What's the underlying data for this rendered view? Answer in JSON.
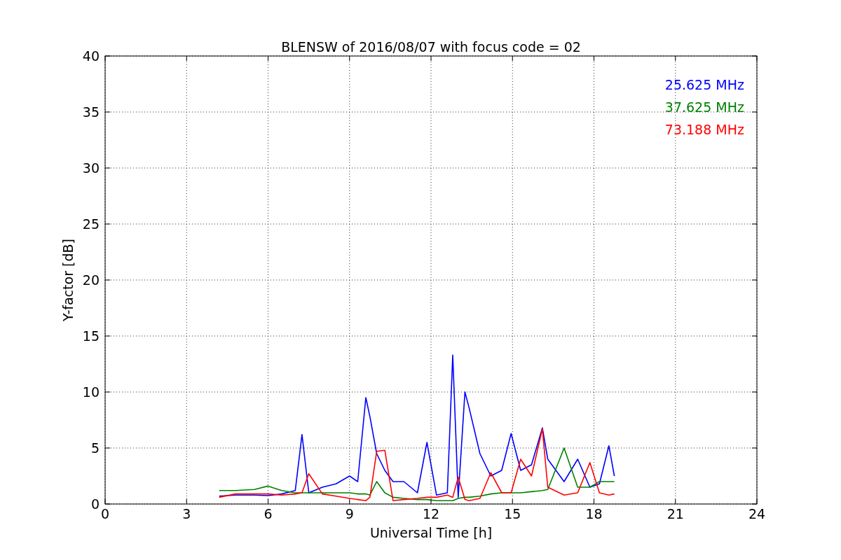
{
  "chart_data": {
    "type": "line",
    "title": "BLENSW of 2016/08/07 with focus code = 02",
    "xlabel": "Universal Time [h]",
    "ylabel": "Y-factor [dB]",
    "x": [
      4.2,
      4.8,
      5.5,
      6.0,
      6.5,
      7.0,
      7.25,
      7.5,
      8.0,
      8.5,
      9.0,
      9.3,
      9.6,
      9.75,
      10.0,
      10.3,
      10.6,
      11.0,
      11.5,
      11.85,
      12.2,
      12.6,
      12.8,
      13.0,
      13.25,
      13.4,
      13.8,
      14.2,
      14.6,
      14.95,
      15.3,
      15.7,
      16.1,
      16.3,
      16.9,
      17.4,
      17.85,
      18.2,
      18.55,
      18.75
    ],
    "series": [
      {
        "name": "25.625 MHz",
        "color": "#0000ff",
        "values": [
          0.7,
          0.8,
          0.8,
          0.75,
          0.9,
          1.2,
          6.2,
          1.0,
          1.5,
          1.8,
          2.5,
          2.0,
          9.5,
          7.8,
          4.5,
          3.0,
          2.0,
          2.0,
          1.0,
          5.5,
          0.8,
          1.0,
          13.3,
          0.6,
          10.0,
          8.6,
          4.5,
          2.5,
          3.0,
          6.3,
          3.0,
          3.5,
          6.8,
          4.0,
          2.0,
          4.0,
          1.5,
          1.8,
          5.2,
          2.5
        ]
      },
      {
        "name": "37.625 MHz",
        "color": "#008000",
        "values": [
          1.2,
          1.2,
          1.3,
          1.6,
          1.2,
          1.0,
          1.0,
          1.0,
          1.0,
          1.0,
          1.0,
          0.9,
          0.9,
          0.8,
          2.0,
          1.0,
          0.6,
          0.5,
          0.4,
          0.4,
          0.3,
          0.3,
          0.3,
          0.5,
          0.6,
          0.6,
          0.7,
          0.9,
          1.0,
          1.0,
          1.0,
          1.1,
          1.2,
          1.3,
          5.0,
          1.5,
          1.5,
          2.0,
          2.0,
          2.0
        ]
      },
      {
        "name": "73.188 MHz",
        "color": "#ff0000",
        "values": [
          0.6,
          0.9,
          0.9,
          0.9,
          0.8,
          0.9,
          1.0,
          2.7,
          0.9,
          0.7,
          0.5,
          0.4,
          0.3,
          0.6,
          4.7,
          4.8,
          0.3,
          0.4,
          0.5,
          0.6,
          0.6,
          0.8,
          0.6,
          2.4,
          0.4,
          0.3,
          0.5,
          2.8,
          1.0,
          1.0,
          4.0,
          2.5,
          6.7,
          1.5,
          0.8,
          1.0,
          3.7,
          1.0,
          0.8,
          0.9
        ]
      }
    ],
    "xlim": [
      0,
      24
    ],
    "ylim": [
      0,
      40
    ],
    "xticks": [
      0,
      3,
      6,
      9,
      12,
      15,
      18,
      21,
      24
    ],
    "yticks": [
      0,
      5,
      10,
      15,
      20,
      25,
      30,
      35,
      40
    ],
    "grid": true
  }
}
